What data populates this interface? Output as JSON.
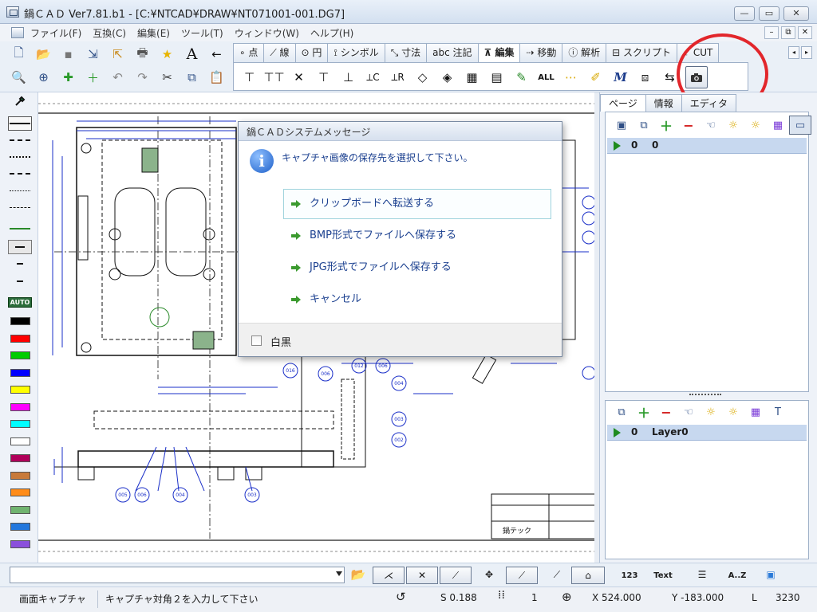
{
  "window": {
    "title": "鍋ＣＡＤ Ver7.81.b1 - [C:¥NTCAD¥DRAW¥NT071001-001.DG7]",
    "minimize": "—",
    "maximize": "▭",
    "close": "✕"
  },
  "menu": {
    "items": [
      "ファイル(F)",
      "互換(C)",
      "編集(E)",
      "ツール(T)",
      "ウィンドウ(W)",
      "ヘルプ(H)"
    ],
    "mdi": [
      "–",
      "⧉",
      "✕"
    ]
  },
  "toolbar": {
    "row1": [
      "new-file-icon",
      "open-folder-icon",
      "save-icon",
      "import-icon",
      "export-icon",
      "print-icon",
      "star-icon",
      "text-icon",
      "arrow-left-icon"
    ],
    "row1_glyphs": [
      "🗋",
      "📂",
      "▪",
      "⇲",
      "⇱",
      "🖶",
      "★",
      "A",
      "←"
    ],
    "row2_glyphs": [
      "🔍",
      "⊕",
      "✚",
      "＋",
      "↶",
      "↷",
      "✂",
      "⧉",
      "📋"
    ],
    "tabs": [
      "∘ 点",
      "⟋ 線",
      "⊙ 円",
      "⟟ シンボル",
      "⤡ 寸法",
      "abc 注記",
      "⊼ 編集",
      "⇢ 移動",
      "ⓘ 解析",
      "⊟ スクリプト",
      "⸔ CUT"
    ],
    "active_tab": "⊼ 編集",
    "tab_scroll": [
      "◂",
      "▸"
    ],
    "edit_glyphs": [
      "⊤",
      "⊤⊤",
      "✕",
      "⊤",
      "⊥",
      "⟂C",
      "⟂R",
      "◇",
      "◈",
      "▦",
      "▤",
      "✎",
      "ALL",
      "⋯",
      "✐",
      "M",
      "⧈",
      "⇆",
      "⌂"
    ]
  },
  "palette": {
    "auto_label": "AUTO",
    "colors": [
      "#000000",
      "#ff0000",
      "#00cc00",
      "#0000ff",
      "#ffff00",
      "#ff00ff",
      "#00ffff",
      "#ffffff",
      "#b0005a",
      "#c87a3a",
      "#ff8c1a",
      "#6fb36f",
      "#2277dd",
      "#8a4fdc"
    ]
  },
  "right_panel": {
    "tabs": [
      "ページ",
      "情報",
      "エディタ"
    ],
    "active_tab": "ページ",
    "page_row": {
      "num": "0",
      "name": "0"
    },
    "layer_row": {
      "num": "0",
      "name": "Layer0"
    }
  },
  "dialog": {
    "title": "鍋ＣＡＤシステムメッセージ",
    "message": "キャプチャ画像の保存先を選択して下さい。",
    "options": [
      "クリップボードへ転送する",
      "BMP形式でファイルへ保存する",
      "JPG形式でファイルへ保存する",
      "キャンセル"
    ],
    "checkbox_label": "白黒"
  },
  "drawing": {
    "title_block": "鍋テック",
    "balloons": [
      "016",
      "006",
      "012",
      "006",
      "004",
      "003",
      "002",
      "005",
      "006",
      "004",
      "003"
    ]
  },
  "cmdbar": {
    "text_label": "Text",
    "az_label": "A..Z",
    "num_label": "123"
  },
  "status": {
    "mode": "画面キャプチャ",
    "prompt": "キャプチャ対角２を入力して下さい",
    "scale": "S 0.188",
    "grid": "1",
    "x": "X 524.000",
    "y": "Y -183.000",
    "l": "L",
    "l_value": "3230"
  }
}
